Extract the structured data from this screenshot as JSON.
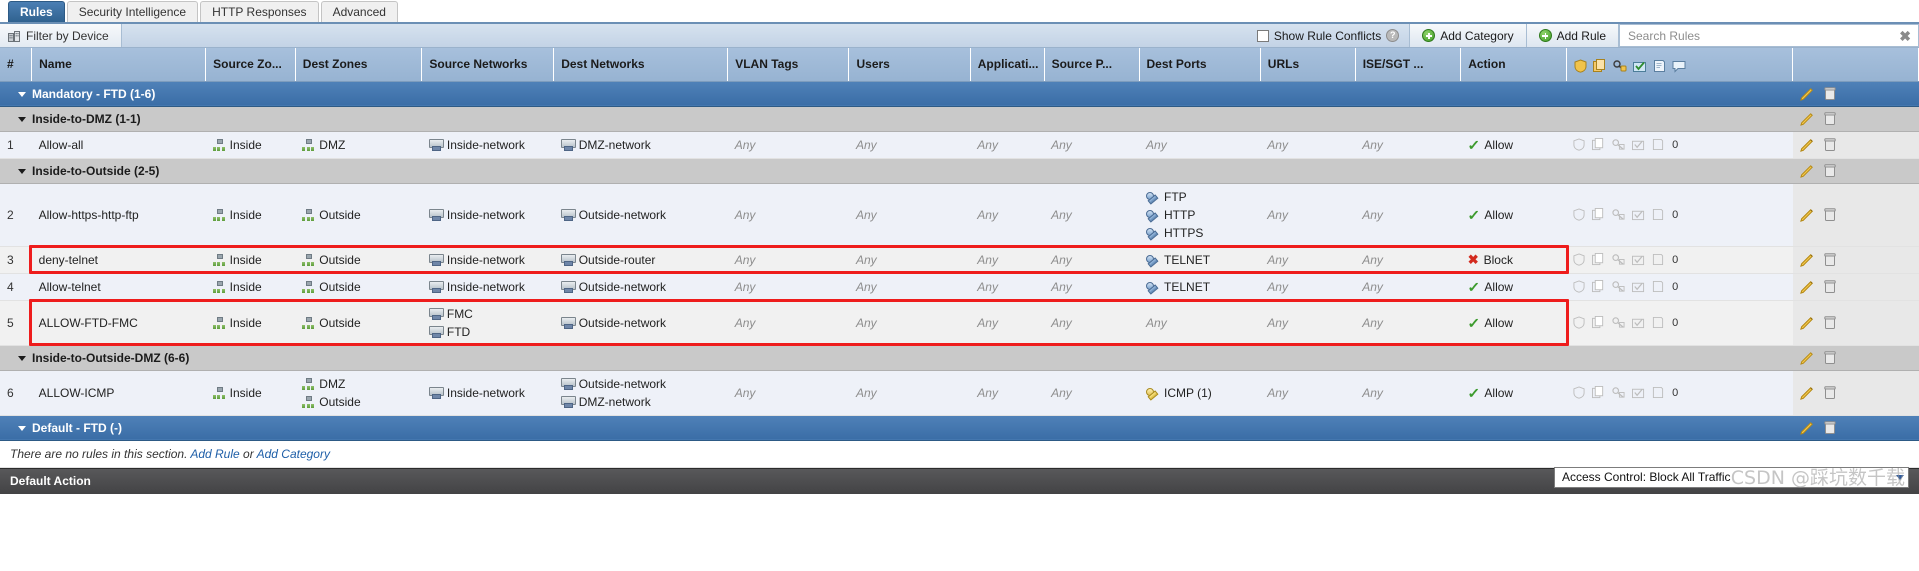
{
  "tabs": [
    {
      "label": "Rules",
      "active": true
    },
    {
      "label": "Security Intelligence",
      "active": false
    },
    {
      "label": "HTTP Responses",
      "active": false
    },
    {
      "label": "Advanced",
      "active": false
    }
  ],
  "toolbar": {
    "filter_by_device": "Filter by Device",
    "show_rule_conflicts": "Show Rule Conflicts",
    "add_category": "Add Category",
    "add_rule": "Add Rule",
    "search_placeholder": "Search Rules",
    "search_value": "",
    "clear_search": "✖",
    "help_icon": "help-icon",
    "device_icon": "device-filter-icon"
  },
  "columns": [
    "#",
    "Name",
    "Source Zo...",
    "Dest Zones",
    "Source Networks",
    "Dest Networks",
    "VLAN Tags",
    "Users",
    "Applicati...",
    "Source P...",
    "Dest Ports",
    "URLs",
    "ISE/SGT ...",
    "Action"
  ],
  "header_icons": [
    "shield-icon",
    "copy-icon",
    "key-icon",
    "folder-check-icon",
    "log-icon",
    "comment-icon"
  ],
  "sections": [
    {
      "id": "mandatory",
      "type": "major",
      "title": "Mandatory - FTD (1-6)",
      "children": [
        {
          "id": "inside-to-dmz",
          "type": "minor",
          "title": "Inside-to-DMZ (1-1)",
          "rules": [
            {
              "num": "1",
              "name": "Allow-all",
              "source_zones": [
                "Inside"
              ],
              "dest_zones": [
                "DMZ"
              ],
              "source_networks": [
                "Inside-network"
              ],
              "dest_networks": [
                "DMZ-network"
              ],
              "vlan_tags": "Any",
              "users": "Any",
              "applications": "Any",
              "source_ports": "Any",
              "dest_ports": [],
              "dest_ports_any": "Any",
              "urls": "Any",
              "ise_sgt": "Any",
              "action": "Allow",
              "action_type": "allow",
              "log_count": "0",
              "highlighted": false
            }
          ]
        },
        {
          "id": "inside-to-outside",
          "type": "minor",
          "title": "Inside-to-Outside (2-5)",
          "rules": [
            {
              "num": "2",
              "name": "Allow-https-http-ftp",
              "source_zones": [
                "Inside"
              ],
              "dest_zones": [
                "Outside"
              ],
              "source_networks": [
                "Inside-network"
              ],
              "dest_networks": [
                "Outside-network"
              ],
              "vlan_tags": "Any",
              "users": "Any",
              "applications": "Any",
              "source_ports": "Any",
              "dest_ports": [
                "FTP",
                "HTTP",
                "HTTPS"
              ],
              "dest_ports_any": "",
              "urls": "Any",
              "ise_sgt": "Any",
              "action": "Allow",
              "action_type": "allow",
              "log_count": "0",
              "highlighted": false
            },
            {
              "num": "3",
              "name": "deny-telnet",
              "source_zones": [
                "Inside"
              ],
              "dest_zones": [
                "Outside"
              ],
              "source_networks": [
                "Inside-network"
              ],
              "dest_networks": [
                "Outside-router"
              ],
              "vlan_tags": "Any",
              "users": "Any",
              "applications": "Any",
              "source_ports": "Any",
              "dest_ports": [
                "TELNET"
              ],
              "dest_ports_any": "",
              "urls": "Any",
              "ise_sgt": "Any",
              "action": "Block",
              "action_type": "block",
              "log_count": "0",
              "highlighted": true
            },
            {
              "num": "4",
              "name": "Allow-telnet",
              "source_zones": [
                "Inside"
              ],
              "dest_zones": [
                "Outside"
              ],
              "source_networks": [
                "Inside-network"
              ],
              "dest_networks": [
                "Outside-network"
              ],
              "vlan_tags": "Any",
              "users": "Any",
              "applications": "Any",
              "source_ports": "Any",
              "dest_ports": [
                "TELNET"
              ],
              "dest_ports_any": "",
              "urls": "Any",
              "ise_sgt": "Any",
              "action": "Allow",
              "action_type": "allow",
              "log_count": "0",
              "highlighted": false
            },
            {
              "num": "5",
              "name": "ALLOW-FTD-FMC",
              "source_zones": [
                "Inside"
              ],
              "dest_zones": [
                "Outside"
              ],
              "source_networks": [
                "FMC",
                "FTD"
              ],
              "dest_networks": [
                "Outside-network"
              ],
              "vlan_tags": "Any",
              "users": "Any",
              "applications": "Any",
              "source_ports": "Any",
              "dest_ports": [],
              "dest_ports_any": "Any",
              "urls": "Any",
              "ise_sgt": "Any",
              "action": "Allow",
              "action_type": "allow",
              "log_count": "0",
              "highlighted": true
            }
          ]
        },
        {
          "id": "inside-to-outside-dmz",
          "type": "minor",
          "title": "Inside-to-Outside-DMZ (6-6)",
          "rules": [
            {
              "num": "6",
              "name": "ALLOW-ICMP",
              "source_zones": [
                "Inside"
              ],
              "dest_zones": [
                "DMZ",
                "Outside"
              ],
              "source_networks": [
                "Inside-network"
              ],
              "dest_networks": [
                "Outside-network",
                "DMZ-network"
              ],
              "vlan_tags": "Any",
              "users": "Any",
              "applications": "Any",
              "source_ports": "Any",
              "dest_ports": [
                "ICMP (1)"
              ],
              "dest_ports_any": "",
              "urls": "Any",
              "ise_sgt": "Any",
              "action": "Allow",
              "action_type": "allow",
              "log_count": "0",
              "highlighted": false
            }
          ]
        }
      ]
    },
    {
      "id": "default-ftd",
      "type": "major",
      "title": "Default - FTD (-)",
      "empty_message_prefix": "There are no rules in this section. ",
      "empty_link_1": "Add Rule",
      "empty_message_mid": " or ",
      "empty_link_2": "Add Category",
      "children": []
    }
  ],
  "footer": {
    "default_action_label": "Default Action",
    "default_action_value": "Access Control: Block All Traffic",
    "watermark": "CSDN @踩坑数千载"
  },
  "colors": {
    "accent_blue": "#3a6da6",
    "highlight_red": "#ee1c1c",
    "allow_green": "#3d9b2e",
    "block_red": "#d32b1f",
    "header_blue": "#9fb9d6"
  }
}
